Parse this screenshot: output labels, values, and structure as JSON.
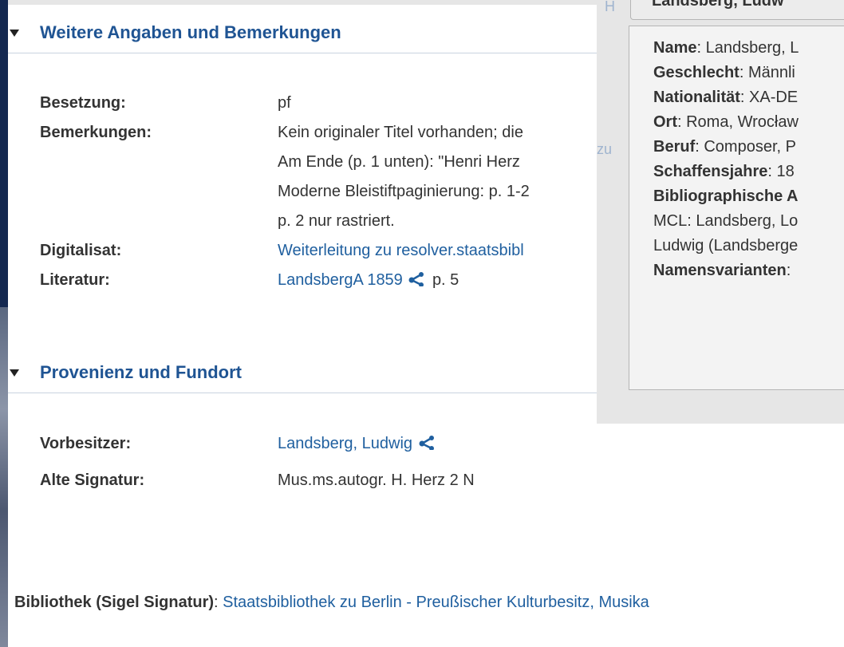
{
  "section1": {
    "title": "Weitere Angaben und Bemerkungen",
    "rows": [
      {
        "label": "Besetzung:",
        "value": "pf"
      },
      {
        "label": "Bemerkungen:",
        "lines": [
          "Kein originaler Titel vorhanden; die",
          "Am Ende (p. 1 unten): \"Henri Herz",
          "Moderne Bleistiftpaginierung: p. 1-2",
          "p. 2 nur rastriert."
        ]
      },
      {
        "label": "Digitalisat:",
        "link": "Weiterleitung zu resolver.staatsbibl"
      },
      {
        "label": "Literatur:",
        "link": "LandsbergA 1859",
        "suffix": "p. 5"
      }
    ]
  },
  "section2": {
    "title": "Provenienz und Fundort",
    "rows": [
      {
        "label": "Vorbesitzer:",
        "link": "Landsberg, Ludwig"
      },
      {
        "label": "Alte Signatur:",
        "value": "Mus.ms.autogr. H. Herz 2 N"
      }
    ]
  },
  "footer": {
    "label": "Bibliothek (Sigel Signatur)",
    "colon": ":",
    "link": "Staatsbibliothek zu Berlin - Preußischer Kulturbesitz, Musika"
  },
  "popup": {
    "head": "Landsberg, Ludw",
    "ghost_left": "H",
    "ghost_zu": "zu",
    "lines": [
      {
        "label": "Name",
        "value": ": Landsberg, L"
      },
      {
        "label": "Geschlecht",
        "value": ": Männli"
      },
      {
        "label": "Nationalität",
        "value": ": XA-DE"
      },
      {
        "label": "Ort",
        "value": ": Roma, Wrocław"
      },
      {
        "label": "Beruf",
        "value": ": Composer, P"
      },
      {
        "label": "Schaffensjahre",
        "value": ": 18"
      },
      {
        "label": "Bibliographische A",
        "value": ""
      },
      {
        "label": "",
        "value": "MCL: Landsberg, Lo"
      },
      {
        "label": "",
        "value": "Ludwig (Landsberge"
      },
      {
        "label": "Namensvarianten",
        "value": ":"
      }
    ]
  },
  "colors": {
    "link": "#1f5f9f",
    "heading": "#1f5493",
    "dark_bg": "#142850"
  }
}
